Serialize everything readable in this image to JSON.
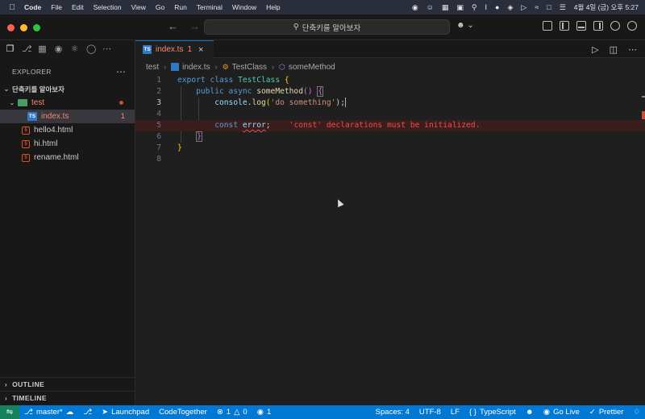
{
  "menubar": {
    "app": "Code",
    "items": [
      "File",
      "Edit",
      "Selection",
      "View",
      "Go",
      "Run",
      "Terminal",
      "Window",
      "Help"
    ],
    "clock": "4월 4일 (금) 오후 5:27"
  },
  "titlebar": {
    "search": "단축키를 알아보자"
  },
  "explorer": {
    "title": "EXPLORER",
    "root": "단축키를 알아보자",
    "folder": "test",
    "files": [
      {
        "name": "index.ts",
        "problems": "1"
      },
      {
        "name": "hello4.html"
      },
      {
        "name": "hi.html"
      },
      {
        "name": "rename.html"
      }
    ],
    "outline": "OUTLINE",
    "timeline": "TIMELINE"
  },
  "tab": {
    "label": "index.ts",
    "count": "1"
  },
  "breadcrumb": {
    "folder": "test",
    "file": "index.ts",
    "class": "TestClass",
    "method": "someMethod"
  },
  "code": {
    "line_numbers": [
      "1",
      "2",
      "3",
      "4",
      "5",
      "6",
      "7",
      "8"
    ],
    "l1": {
      "kw1": "export",
      "kw2": "class",
      "cls": "TestClass",
      "brace": "{"
    },
    "l2": {
      "kw1": "public",
      "kw2": "async",
      "fn": "someMethod",
      "parens": "()",
      "brace": "{"
    },
    "l3": {
      "obj": "console",
      "dot": ".",
      "fn": "log",
      "open": "(",
      "str": "'do something'",
      "close": ");"
    },
    "l5": {
      "kw": "const",
      "var": "error",
      "semi": ";",
      "error": "'const' declarations must be initialized."
    },
    "l6": {
      "brace": "}"
    },
    "l7": {
      "brace": "}"
    }
  },
  "statusbar": {
    "branch": "master*",
    "launchpad": "Launchpad",
    "codetogether": "CodeTogether",
    "errors": "1",
    "warnings": "0",
    "ports": "1",
    "spaces": "Spaces: 4",
    "encoding": "UTF-8",
    "eol": "LF",
    "language": "TypeScript",
    "golive": "Go Live",
    "prettier": "Prettier"
  },
  "colors": {
    "accent": "#0078d4",
    "error": "#f14c4c",
    "remote": "#16825d"
  }
}
